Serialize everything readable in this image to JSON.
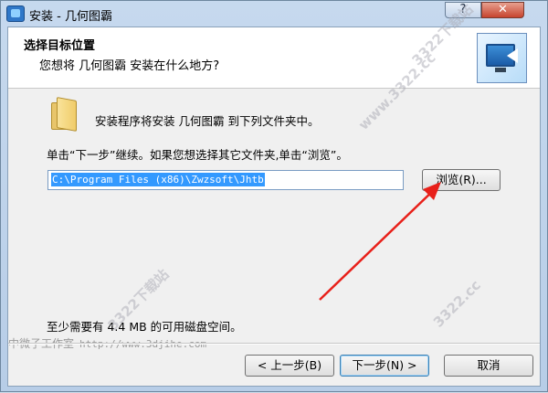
{
  "window": {
    "title": "安装 - 几何图霸",
    "help_label": "?",
    "close_label": "✕"
  },
  "header": {
    "title": "选择目标位置",
    "subtitle": "您想将 几何图霸 安装在什么地方?"
  },
  "body": {
    "install_text": "安装程序将安装 几何图霸 到下列文件夹中。",
    "click_text": "单击“下一步”继续。如果您想选择其它文件夹,单击“浏览”。",
    "path_value": "C:\\Program Files (x86)\\Zwzsoft\\Jhtb",
    "browse_label": "浏览(R)...",
    "space_text": "至少需要有 4.4 MB 的可用磁盘空间。"
  },
  "footer": {
    "back_label": "< 上一步(B)",
    "next_label": "下一步(N) >",
    "cancel_label": "取消"
  },
  "watermark": {
    "left_text": "中微子工作室",
    "site": "http://www.3djihe.com",
    "diagonal_1": "www.3322.cc",
    "diagonal_2": "3322下载站",
    "diagonal_3": "3322.cc",
    "diagonal_4": "3322下载站"
  },
  "colors": {
    "arrow": "#e8201a",
    "selection": "#3399ff"
  }
}
